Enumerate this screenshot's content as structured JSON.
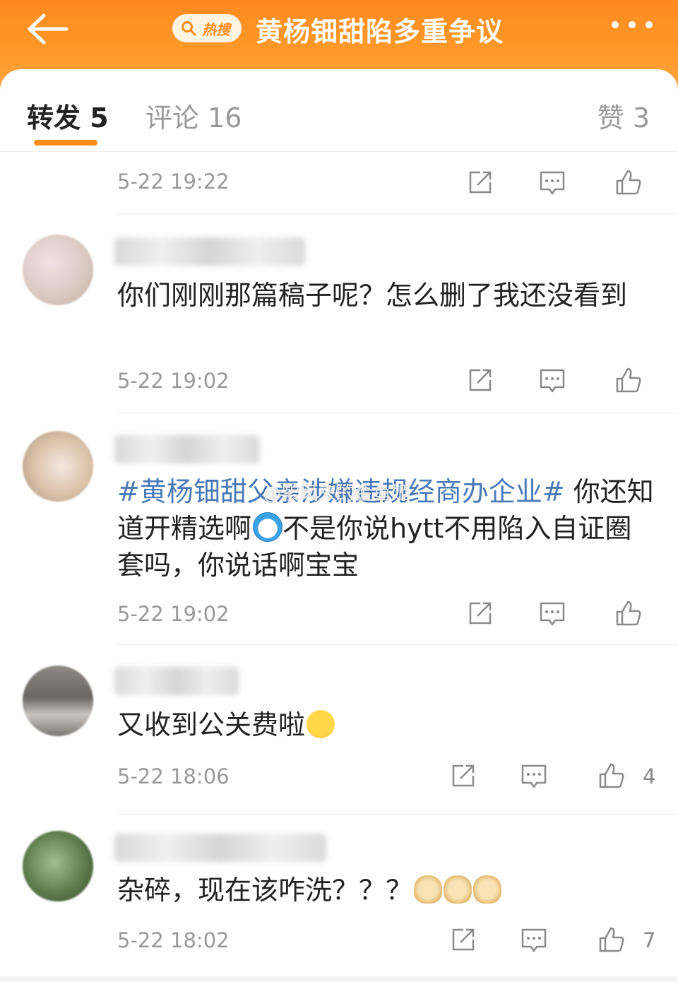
{
  "header": {
    "back_icon": "arrow-left-icon",
    "hot_badge_label": "热搜",
    "title": "黄杨钿甜陷多重争议",
    "more_icon": "ellipsis-icon"
  },
  "tabs": [
    {
      "label": "转发 5"
    },
    {
      "label": "评论 16"
    },
    {
      "label": "赞 3"
    }
  ],
  "actions_icons": [
    "share-icon",
    "comment-icon",
    "like-icon"
  ],
  "top_item": {
    "time": "5-22 19:22"
  },
  "comments": [
    {
      "text": "你们刚刚那篇稿子呢？怎么删了我还没看到",
      "time": "5-22 19:02",
      "likes": ""
    },
    {
      "tag": "#黄杨钿甜父亲涉嫌违规经商办企业#",
      "text_part1": " 你还知道开精选啊",
      "emoji1": "doraemon-emoji",
      "text_part2": "不是你说hytt不用陷入自证圈套吗，你说话啊宝宝",
      "time": "5-22 19:02",
      "likes": ""
    },
    {
      "text": "又收到公关费啦",
      "emoji": "tongue-emoji",
      "time": "5-22 18:06",
      "likes": "4"
    },
    {
      "text": "杂碎，现在该咋洗？？？",
      "emoji": "doge-emoji",
      "time": "5-22 18:02",
      "likes": "7"
    }
  ],
  "watermark": "@紫风来的金鱼姬",
  "colors": {
    "accent": "#ff8a1e",
    "tag": "#4a79b8",
    "muted": "#999999"
  }
}
